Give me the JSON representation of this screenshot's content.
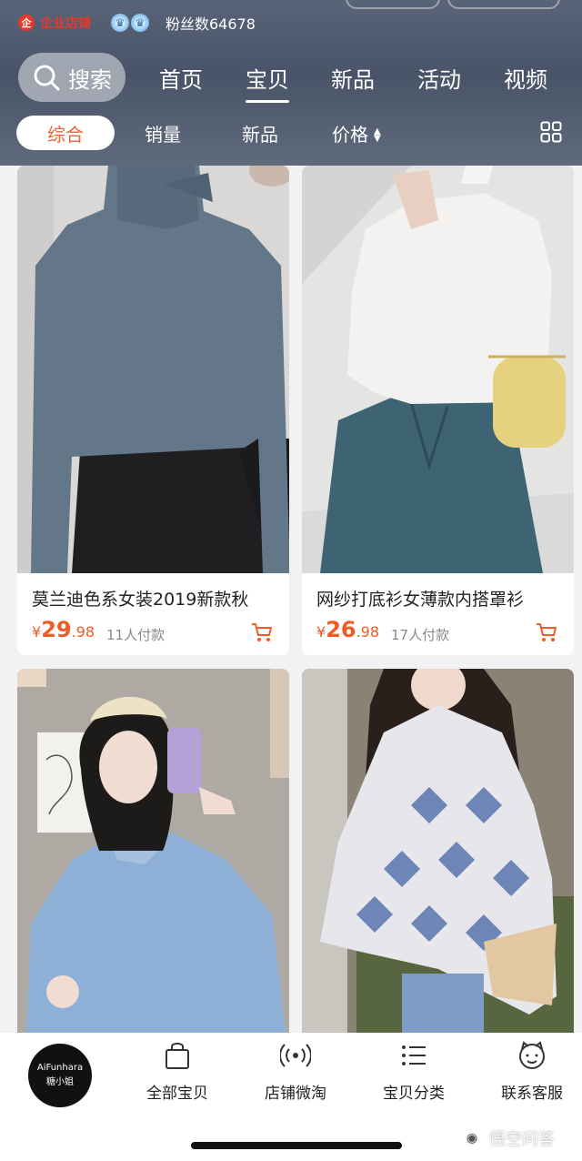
{
  "header": {
    "shop_badge": "企业店铺",
    "fans_label": "粉丝数64678",
    "search_label": "搜索",
    "tabs": [
      {
        "label": "首页",
        "active": false
      },
      {
        "label": "宝贝",
        "active": true
      },
      {
        "label": "新品",
        "active": false
      },
      {
        "label": "活动",
        "active": false
      },
      {
        "label": "视频",
        "active": false
      }
    ]
  },
  "filters": {
    "items": [
      "综合",
      "销量",
      "新品",
      "价格"
    ],
    "active": "综合"
  },
  "products": [
    {
      "title": "莫兰迪色系女装2019新款秋",
      "price_symbol": "¥",
      "price_main": "29",
      "price_decimal": ".98",
      "sold": "11人付款"
    },
    {
      "title": "网纱打底衫女薄款内搭罩衫",
      "price_symbol": "¥",
      "price_main": "26",
      "price_decimal": ".98",
      "sold": "17人付款"
    },
    {
      "title": "",
      "price_symbol": "",
      "price_main": "",
      "price_decimal": "",
      "sold": ""
    },
    {
      "title": "",
      "price_symbol": "",
      "price_main": "",
      "price_decimal": "",
      "sold": ""
    }
  ],
  "bottom_bar": {
    "avatar_line1": "AiFunhara",
    "avatar_line2": "糖小姐",
    "items": [
      "全部宝贝",
      "店铺微淘",
      "宝贝分类",
      "联系客服"
    ]
  },
  "watermark": "悟空问答",
  "colors": {
    "accent": "#f05a24",
    "header": "#525c70"
  }
}
